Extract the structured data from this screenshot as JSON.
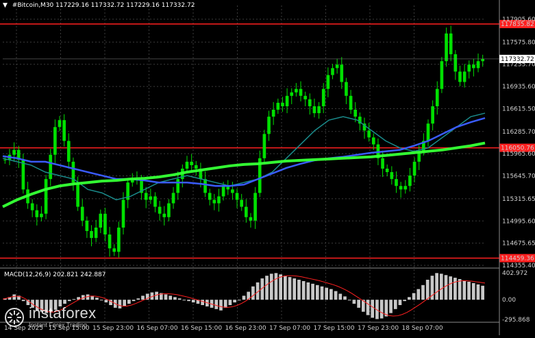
{
  "header": {
    "symbol": "#Bitcoin,M30",
    "ohlc": "117229.16 117332.72 117229.16 117332.72"
  },
  "macd": {
    "label": "MACD(12,26,9) 202.821 242.887",
    "axis_ticks": [
      "402.972",
      "0.00",
      "-295.868"
    ]
  },
  "logo": {
    "name": "instaforex",
    "tagline": "Instant Forex Trading",
    "icon": "instaforex-sunburst-icon"
  },
  "colors": {
    "background": "#000000",
    "candle": "#00e000",
    "level_line": "#ff2020",
    "ma_fast": "#1a8c8c",
    "ma_mid": "#3a5cff",
    "ma_slow": "#33ff33",
    "macd_hist": "#c8c8c8",
    "macd_signal": "#ff2020"
  },
  "chart_data": {
    "type": "candlestick",
    "symbol": "#Bitcoin",
    "timeframe": "M30",
    "ylim": [
      114355.4,
      117905.6
    ],
    "y_ticks": [
      "117905.60",
      "117575.80",
      "117255.70",
      "116935.60",
      "116615.50",
      "116285.70",
      "115965.60",
      "115645.70",
      "115315.65",
      "114995.60",
      "114675.65",
      "114355.40"
    ],
    "x_ticks": [
      "14 Sep 2025",
      "15 Sep 15:00",
      "15 Sep 23:00",
      "16 Sep 07:00",
      "16 Sep 15:00",
      "16 Sep 23:00",
      "17 Sep 07:00",
      "17 Sep 15:00",
      "17 Sep 23:00",
      "18 Sep 07:00"
    ],
    "levels": [
      {
        "label": "117835.82",
        "value": 117835.82
      },
      {
        "label": "116050.76",
        "value": 116050.76
      },
      {
        "label": "114459.36",
        "value": 114459.36
      }
    ],
    "current_price": {
      "label": "117332.72",
      "value": 117332.72
    },
    "close_series": [
      115880,
      115950,
      116020,
      115880,
      115450,
      115250,
      115150,
      115050,
      115100,
      115600,
      115950,
      116350,
      116450,
      116150,
      115850,
      115550,
      115200,
      115000,
      114850,
      114750,
      114900,
      115100,
      114800,
      114600,
      114550,
      114900,
      115300,
      115550,
      115600,
      115600,
      115400,
      115300,
      115350,
      115200,
      115100,
      115050,
      115250,
      115400,
      115600,
      115750,
      115850,
      115800,
      115750,
      115600,
      115400,
      115300,
      115250,
      115350,
      115500,
      115450,
      115400,
      115300,
      115200,
      115050,
      115000,
      115400,
      115900,
      116250,
      116500,
      116600,
      116700,
      116650,
      116800,
      116850,
      116900,
      116800,
      116750,
      116650,
      116550,
      116650,
      116900,
      117100,
      117200,
      117250,
      117000,
      116800,
      116600,
      116500,
      116400,
      116300,
      116200,
      116100,
      115900,
      115750,
      115700,
      115600,
      115500,
      115450,
      115500,
      115650,
      115850,
      116000,
      116150,
      116400,
      116650,
      116900,
      117300,
      117700,
      117400,
      117150,
      117000,
      117150,
      117250,
      117200,
      117300,
      117332.72
    ],
    "moving_averages": [
      {
        "color": "#1a8c8c",
        "values": [
          115900,
          115850,
          115800,
          115700,
          115650,
          115600,
          115450,
          115400,
          115300,
          115350,
          115450,
          115550,
          115600,
          115650,
          115600,
          115550,
          115500,
          115550,
          115600,
          115700,
          115900,
          116100,
          116300,
          116450,
          116500,
          116450,
          116300,
          116150,
          116050,
          116000,
          116050,
          116200,
          116350,
          116500,
          116550
        ]
      },
      {
        "color": "#3a5cff",
        "values": [
          115930,
          115900,
          115850,
          115850,
          115800,
          115750,
          115700,
          115650,
          115600,
          115600,
          115580,
          115550,
          115550,
          115550,
          115530,
          115500,
          115500,
          115520,
          115600,
          115680,
          115760,
          115820,
          115870,
          115900,
          115920,
          115950,
          115980,
          116000,
          116020,
          116080,
          116150,
          116250,
          116350,
          116420,
          116480
        ]
      },
      {
        "color": "#33ff33",
        "values": [
          115200,
          115300,
          115380,
          115450,
          115500,
          115530,
          115550,
          115570,
          115580,
          115600,
          115610,
          115630,
          115660,
          115700,
          115730,
          115760,
          115790,
          115810,
          115820,
          115840,
          115860,
          115870,
          115880,
          115890,
          115900,
          115910,
          115920,
          115940,
          115960,
          115980,
          116000,
          116020,
          116050,
          116080,
          116120
        ]
      }
    ],
    "macd_hist": [
      20,
      40,
      80,
      60,
      -20,
      -80,
      -120,
      -160,
      -180,
      -200,
      -190,
      -150,
      -100,
      -60,
      -20,
      10,
      40,
      70,
      80,
      60,
      30,
      0,
      -40,
      -80,
      -120,
      -130,
      -100,
      -60,
      -20,
      20,
      60,
      90,
      110,
      120,
      100,
      80,
      60,
      40,
      20,
      0,
      -20,
      -40,
      -60,
      -80,
      -100,
      -120,
      -140,
      -160,
      -120,
      -80,
      -40,
      0,
      60,
      120,
      200,
      260,
      320,
      360,
      390,
      400,
      380,
      360,
      340,
      320,
      300,
      280,
      260,
      240,
      220,
      200,
      180,
      160,
      130,
      90,
      50,
      0,
      -60,
      -120,
      -180,
      -230,
      -270,
      -290,
      -280,
      -250,
      -200,
      -140,
      -80,
      -20,
      40,
      100,
      160,
      220,
      300,
      360,
      400,
      390,
      370,
      350,
      330,
      310,
      290,
      270,
      250,
      230,
      210
    ],
    "macd_signal": [
      10,
      25,
      45,
      55,
      45,
      10,
      -40,
      -90,
      -130,
      -160,
      -180,
      -185,
      -170,
      -140,
      -100,
      -60,
      -20,
      15,
      40,
      55,
      55,
      45,
      25,
      -5,
      -40,
      -75,
      -95,
      -95,
      -80,
      -55,
      -25,
      5,
      35,
      60,
      80,
      90,
      90,
      85,
      75,
      60,
      45,
      25,
      5,
      -15,
      -35,
      -55,
      -75,
      -95,
      -110,
      -115,
      -105,
      -85,
      -55,
      -15,
      35,
      90,
      145,
      200,
      250,
      295,
      330,
      350,
      360,
      360,
      355,
      345,
      330,
      315,
      300,
      285,
      265,
      245,
      225,
      200,
      170,
      135,
      95,
      50,
      5,
      -40,
      -85,
      -130,
      -175,
      -210,
      -235,
      -245,
      -240,
      -220,
      -190,
      -150,
      -105,
      -60,
      -10,
      40,
      90,
      140,
      185,
      225,
      255,
      275,
      285,
      285,
      280,
      270,
      260,
      250
    ]
  }
}
